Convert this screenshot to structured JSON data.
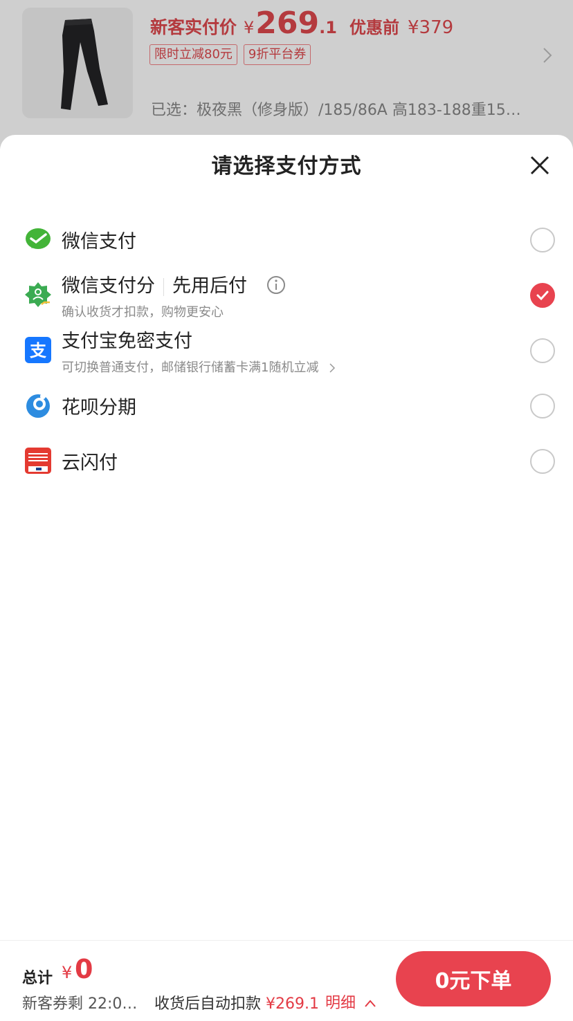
{
  "product": {
    "price_label": "新客实付价",
    "price_yen": "¥",
    "price_int": "269",
    "price_dec": ".1",
    "original_label": "优惠前",
    "original_price": "¥379",
    "tags": [
      "限时立减80元",
      "9折平台券"
    ],
    "selected": "已选：极夜黑（修身版）/185/86A 高183-188重15…"
  },
  "sheet": {
    "title": "请选择支付方式",
    "options": [
      {
        "title": "微信支付",
        "subtitle": "",
        "extra": "",
        "checked": false,
        "icon": "wechat-pay-icon"
      },
      {
        "title": "微信支付分",
        "subtitle": "确认收货才扣款，购物更安心",
        "extra": "先用后付",
        "checked": true,
        "icon": "wechat-pay-score-icon"
      },
      {
        "title": "支付宝免密支付",
        "subtitle": "可切换普通支付，邮储银行储蓄卡满1随机立减",
        "extra": "",
        "checked": false,
        "icon": "alipay-icon"
      },
      {
        "title": "花呗分期",
        "subtitle": "",
        "extra": "",
        "checked": false,
        "icon": "huabei-icon"
      },
      {
        "title": "云闪付",
        "subtitle": "",
        "extra": "",
        "checked": false,
        "icon": "unionpay-quickpass-icon"
      }
    ]
  },
  "bottom": {
    "total_label": "总计",
    "total_yen": "¥",
    "total_value": "0",
    "coupon_text": "新客券剩 22:0…",
    "auto_deduct_label": "收货后自动扣款",
    "auto_deduct_amount": "¥269.1",
    "detail_label": "明细",
    "order_button": "0元下单"
  },
  "colors": {
    "accent": "#e8434f",
    "price_red": "#b43a3e"
  }
}
